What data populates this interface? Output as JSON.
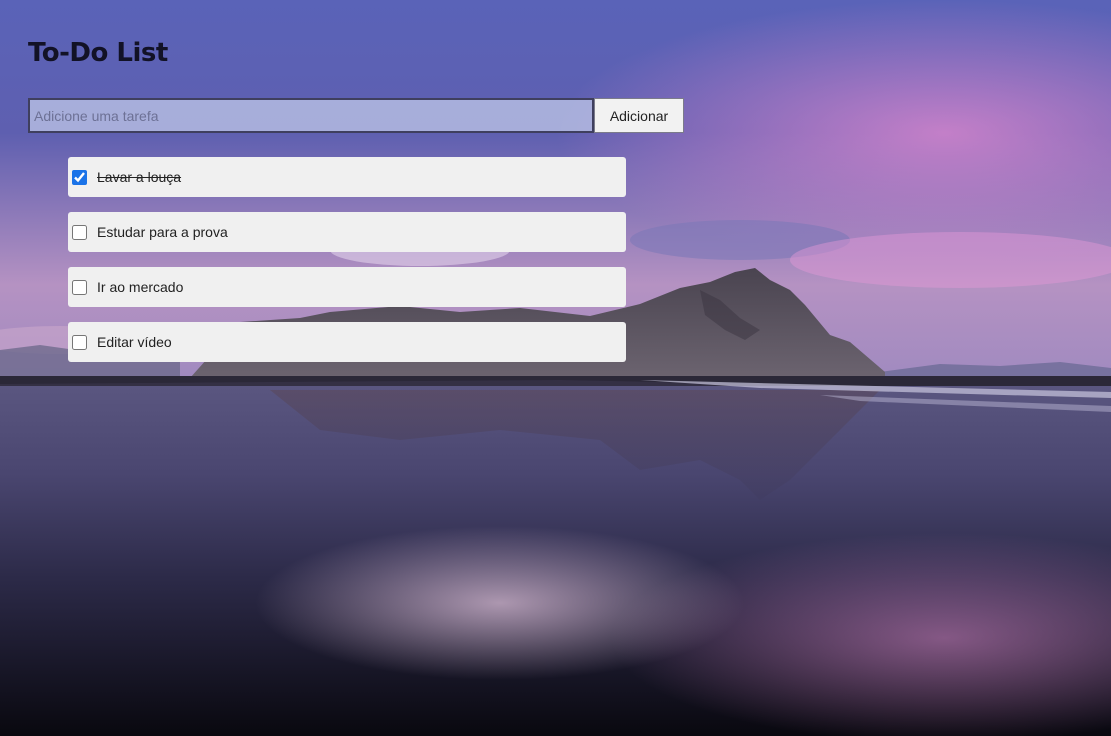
{
  "header": {
    "title": "To-Do List"
  },
  "form": {
    "input_value": "",
    "input_placeholder": "Adicione uma tarefa",
    "add_label": "Adicionar"
  },
  "tasks": [
    {
      "label": "Lavar a louça",
      "done": true
    },
    {
      "label": "Estudar para a prova",
      "done": false
    },
    {
      "label": "Ir ao mercado",
      "done": false
    },
    {
      "label": "Editar vídeo",
      "done": false
    }
  ],
  "colors": {
    "title": "#121226",
    "item_background": "#f0f0f0",
    "checkbox_accent": "#1a73e8"
  }
}
